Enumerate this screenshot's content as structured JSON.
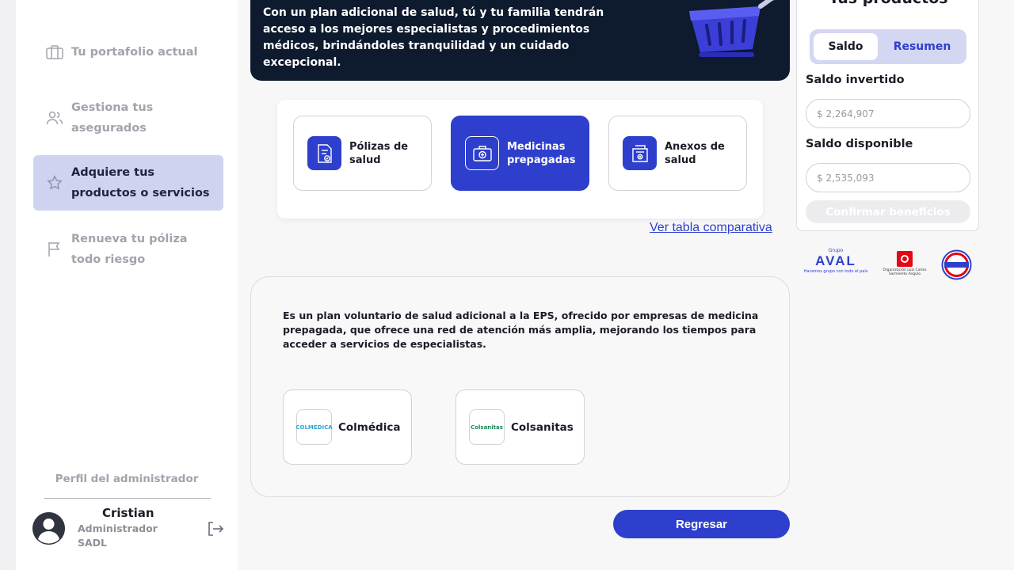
{
  "sidebar": {
    "items": [
      {
        "label": "Tu portafolio actual",
        "icon": "briefcase-icon",
        "active": false
      },
      {
        "label": "Gestiona tus asegurados",
        "icon": "users-icon",
        "active": false
      },
      {
        "label": "Adquiere tus productos o servicios",
        "icon": "star-icon",
        "active": true
      },
      {
        "label": "Renueva tu póliza todo riesgo",
        "icon": "flag-icon",
        "active": false
      }
    ],
    "profile": {
      "title": "Perfil del administrador",
      "name": "Cristian",
      "role": "Administrador",
      "org": "SADL"
    }
  },
  "banner": {
    "text": "Con un plan adicional de salud, tú y tu familia tendrán acceso a los mejores especialistas y procedimientos médicos, brindándoles tranquilidad y un cuidado excepcional."
  },
  "products": [
    {
      "label": "Pólizas de salud",
      "icon": "policy-document-icon",
      "active": false
    },
    {
      "label": "Medicinas prepagadas",
      "icon": "medical-kit-icon",
      "active": true
    },
    {
      "label": "Anexos de salud",
      "icon": "health-annex-icon",
      "active": false
    }
  ],
  "compare_link": "Ver tabla comparativa",
  "description": {
    "text": "Es un plan voluntario de salud adicional a la EPS, ofrecido por empresas de medicina prepagada, que ofrece una red de atención más amplia, mejorando los tiempos para acceder a servicios de especialistas.",
    "providers": [
      {
        "name": "Colmédica",
        "logo_text": "COLMÉDICA",
        "color": "#2aa6d6"
      },
      {
        "name": "Colsanitas",
        "logo_text": "Colsanitas",
        "color": "#1c8a5a"
      }
    ]
  },
  "back_button": "Regresar",
  "right_panel": {
    "title": "Tus productos",
    "tabs": [
      "Saldo",
      "Resumen"
    ],
    "invested_label": "Saldo invertido",
    "invested_value": "$ 2,264,907",
    "available_label": "Saldo disponible",
    "available_value": "$ 2,535,093",
    "confirm_label": "Confirmar beneficios"
  },
  "partners": {
    "aval_top": "Grupo",
    "aval_name": "AVAL",
    "aval_tagline": "Hacemos grupo con todo el país",
    "sarmiento": "Organización Luis Carlos Sarmiento Angulo"
  },
  "colors": {
    "primary": "#2d3fcc",
    "banner_bg": "#0e1a2e",
    "active_nav_bg": "#cfd3f0"
  }
}
